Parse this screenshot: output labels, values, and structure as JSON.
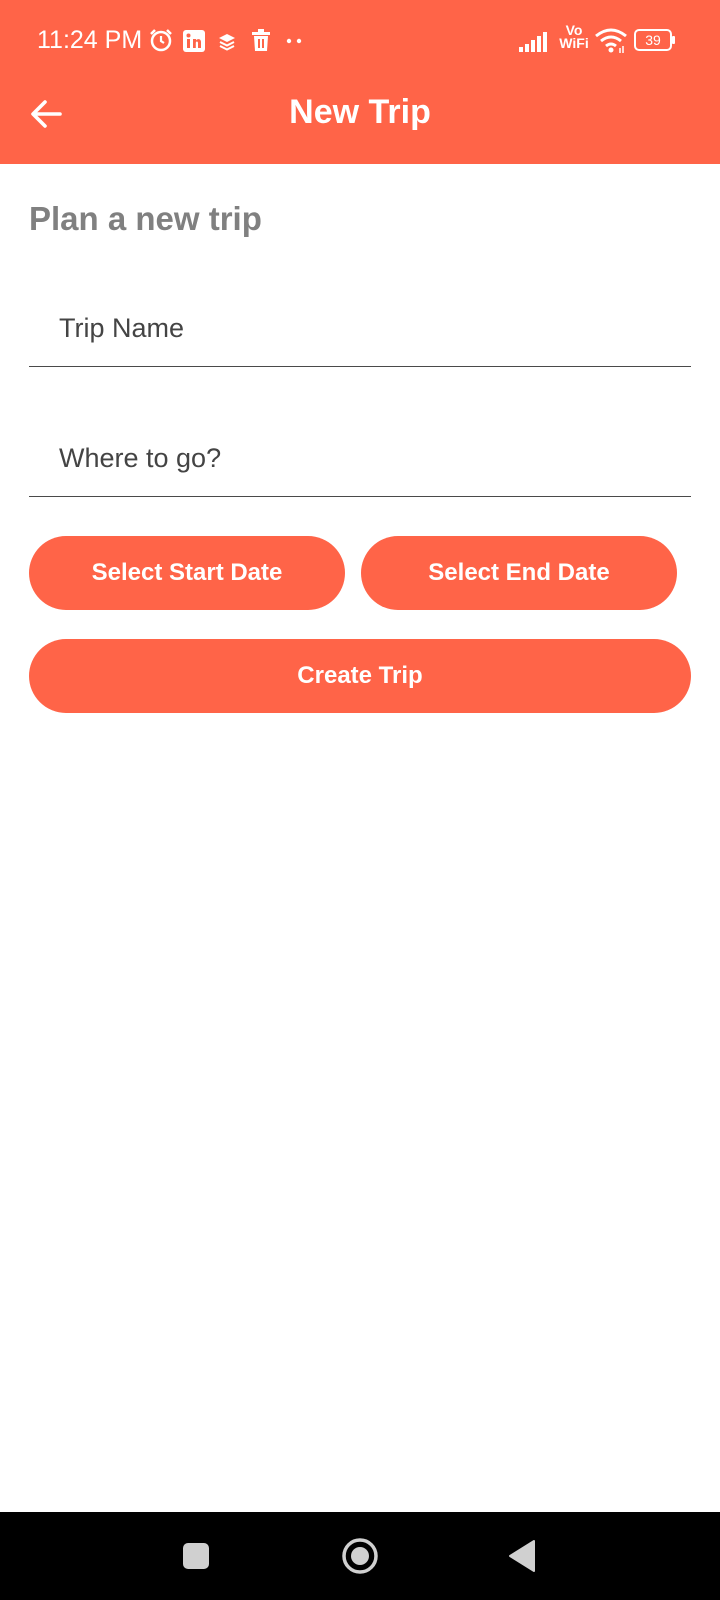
{
  "status_bar": {
    "time": "11:24 PM",
    "icons": [
      "alarm-icon",
      "linkedin-icon",
      "layers-icon",
      "trash-icon",
      "more-dots-icon",
      "signal-icon",
      "vowifi-icon",
      "wifi-icon",
      "battery-icon"
    ],
    "vowifi_top": "Vo",
    "vowifi_bottom": "WiFi",
    "battery": "39"
  },
  "toolbar": {
    "back_icon": "arrow-left-icon",
    "title": "New Trip"
  },
  "form": {
    "heading": "Plan a new trip",
    "trip_name_placeholder": "Trip Name",
    "destination_placeholder": "Where to go?",
    "start_date_label": "Select Start Date",
    "end_date_label": "Select End Date",
    "create_label": "Create Trip"
  },
  "nav_bar": {
    "icons": [
      "recents-square-icon",
      "home-circle-icon",
      "back-triangle-icon"
    ]
  },
  "colors": {
    "accent": "#FF6448",
    "heading_gray": "#808080"
  }
}
